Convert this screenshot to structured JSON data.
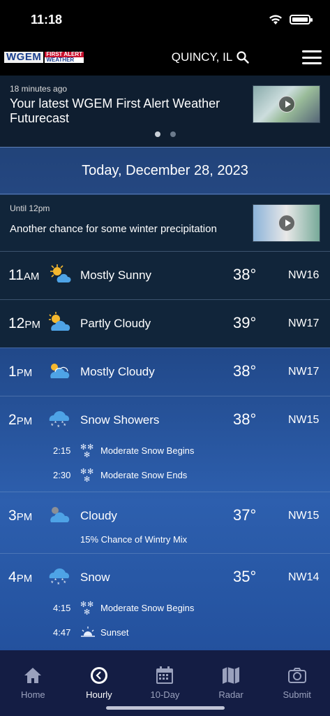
{
  "status": {
    "time": "11:18"
  },
  "header": {
    "logo_main": "WGEM",
    "logo_top": "FIRST ALERT",
    "logo_bottom": "WEATHER",
    "location": "QUINCY, IL"
  },
  "news": {
    "age": "18 minutes ago",
    "title": "Your latest WGEM First Alert Weather Futurecast"
  },
  "date_banner": "Today, December 28, 2023",
  "alert": {
    "until": "Until 12pm",
    "text": "Another chance for some winter precipitation"
  },
  "hours": [
    {
      "hour": "11",
      "ampm": "AM",
      "icon": "sun-cloud-icon",
      "condition": "Mostly Sunny",
      "temp": "38°",
      "wind": "NW16"
    },
    {
      "hour": "12",
      "ampm": "PM",
      "icon": "partly-cloudy-icon",
      "condition": "Partly Cloudy",
      "temp": "39°",
      "wind": "NW17"
    },
    {
      "hour": "1",
      "ampm": "PM",
      "icon": "mostly-cloudy-icon",
      "condition": "Mostly Cloudy",
      "temp": "38°",
      "wind": "NW17"
    },
    {
      "hour": "2",
      "ampm": "PM",
      "icon": "snow-cloud-icon",
      "condition": "Snow Showers",
      "temp": "38°",
      "wind": "NW15",
      "events": [
        {
          "time": "2:15",
          "text": "Moderate Snow Begins"
        },
        {
          "time": "2:30",
          "text": "Moderate Snow Ends"
        }
      ]
    },
    {
      "hour": "3",
      "ampm": "PM",
      "icon": "cloud-icon",
      "condition": "Cloudy",
      "temp": "37°",
      "wind": "NW15",
      "note": "15% Chance of Wintry Mix"
    },
    {
      "hour": "4",
      "ampm": "PM",
      "icon": "snow-cloud-icon",
      "condition": "Snow",
      "temp": "35°",
      "wind": "NW14",
      "events": [
        {
          "time": "4:15",
          "text": "Moderate Snow Begins"
        },
        {
          "time": "4:47",
          "text": "Sunset"
        }
      ]
    }
  ],
  "tabs": [
    {
      "label": "Home",
      "icon": "home-icon"
    },
    {
      "label": "Hourly",
      "icon": "clock-icon",
      "active": true
    },
    {
      "label": "10-Day",
      "icon": "calendar-icon"
    },
    {
      "label": "Radar",
      "icon": "map-icon"
    },
    {
      "label": "Submit",
      "icon": "camera-icon"
    }
  ]
}
